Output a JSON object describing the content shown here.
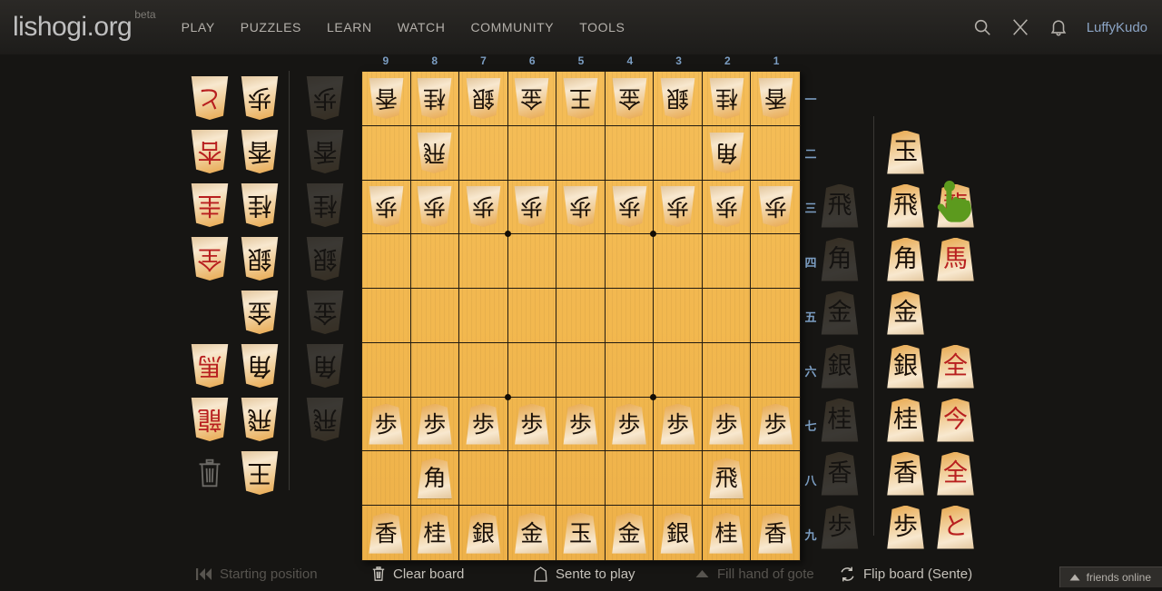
{
  "header": {
    "site_name": "lishogi.org",
    "beta_label": "beta",
    "nav": [
      {
        "label": "PLAY"
      },
      {
        "label": "PUZZLES"
      },
      {
        "label": "LEARN"
      },
      {
        "label": "WATCH"
      },
      {
        "label": "COMMUNITY"
      },
      {
        "label": "TOOLS"
      }
    ],
    "icons": [
      "search-icon",
      "challenge-swords-icon",
      "notifications-bell-icon"
    ],
    "username": "LuffyKudo"
  },
  "board": {
    "file_coords": [
      "9",
      "8",
      "7",
      "6",
      "5",
      "4",
      "3",
      "2",
      "1"
    ],
    "rank_coords": [
      "一",
      "二",
      "三",
      "四",
      "五",
      "六",
      "七",
      "八",
      "九"
    ],
    "rows": [
      [
        {
          "glyph": "香",
          "color": "gote",
          "promoted": false
        },
        {
          "glyph": "桂",
          "color": "gote",
          "promoted": false
        },
        {
          "glyph": "銀",
          "color": "gote",
          "promoted": false
        },
        {
          "glyph": "金",
          "color": "gote",
          "promoted": false
        },
        {
          "glyph": "王",
          "color": "gote",
          "promoted": false
        },
        {
          "glyph": "金",
          "color": "gote",
          "promoted": false
        },
        {
          "glyph": "銀",
          "color": "gote",
          "promoted": false
        },
        {
          "glyph": "桂",
          "color": "gote",
          "promoted": false
        },
        {
          "glyph": "香",
          "color": "gote",
          "promoted": false
        }
      ],
      [
        null,
        {
          "glyph": "飛",
          "color": "gote",
          "promoted": false
        },
        null,
        null,
        null,
        null,
        null,
        {
          "glyph": "角",
          "color": "gote",
          "promoted": false
        },
        null
      ],
      [
        {
          "glyph": "歩",
          "color": "gote",
          "promoted": false
        },
        {
          "glyph": "歩",
          "color": "gote",
          "promoted": false
        },
        {
          "glyph": "歩",
          "color": "gote",
          "promoted": false
        },
        {
          "glyph": "歩",
          "color": "gote",
          "promoted": false
        },
        {
          "glyph": "歩",
          "color": "gote",
          "promoted": false
        },
        {
          "glyph": "歩",
          "color": "gote",
          "promoted": false
        },
        {
          "glyph": "歩",
          "color": "gote",
          "promoted": false
        },
        {
          "glyph": "歩",
          "color": "gote",
          "promoted": false
        },
        {
          "glyph": "歩",
          "color": "gote",
          "promoted": false
        }
      ],
      [
        null,
        null,
        null,
        null,
        null,
        null,
        null,
        null,
        null
      ],
      [
        null,
        null,
        null,
        null,
        null,
        null,
        null,
        null,
        null
      ],
      [
        null,
        null,
        null,
        null,
        null,
        null,
        null,
        null,
        null
      ],
      [
        {
          "glyph": "歩",
          "color": "sente",
          "promoted": false
        },
        {
          "glyph": "歩",
          "color": "sente",
          "promoted": false
        },
        {
          "glyph": "歩",
          "color": "sente",
          "promoted": false
        },
        {
          "glyph": "歩",
          "color": "sente",
          "promoted": false
        },
        {
          "glyph": "歩",
          "color": "sente",
          "promoted": false
        },
        {
          "glyph": "歩",
          "color": "sente",
          "promoted": false
        },
        {
          "glyph": "歩",
          "color": "sente",
          "promoted": false
        },
        {
          "glyph": "歩",
          "color": "sente",
          "promoted": false
        },
        {
          "glyph": "歩",
          "color": "sente",
          "promoted": false
        }
      ],
      [
        null,
        {
          "glyph": "角",
          "color": "sente",
          "promoted": false
        },
        null,
        null,
        null,
        null,
        null,
        {
          "glyph": "飛",
          "color": "sente",
          "promoted": false
        },
        null
      ],
      [
        {
          "glyph": "香",
          "color": "sente",
          "promoted": false
        },
        {
          "glyph": "桂",
          "color": "sente",
          "promoted": false
        },
        {
          "glyph": "銀",
          "color": "sente",
          "promoted": false
        },
        {
          "glyph": "金",
          "color": "sente",
          "promoted": false
        },
        {
          "glyph": "玉",
          "color": "sente",
          "promoted": false
        },
        {
          "glyph": "金",
          "color": "sente",
          "promoted": false
        },
        {
          "glyph": "銀",
          "color": "sente",
          "promoted": false
        },
        {
          "glyph": "桂",
          "color": "sente",
          "promoted": false
        },
        {
          "glyph": "香",
          "color": "sente",
          "promoted": false
        }
      ]
    ]
  },
  "gote_spares": {
    "promoted_column": [
      {
        "glyph": "と",
        "promoted": true
      },
      {
        "glyph": "杏",
        "promoted": true
      },
      {
        "glyph": "圭",
        "promoted": true
      },
      {
        "glyph": "全",
        "promoted": true
      },
      null,
      {
        "glyph": "馬",
        "promoted": true
      },
      {
        "glyph": "龍",
        "promoted": true
      },
      null
    ],
    "plain_column": [
      {
        "glyph": "歩",
        "promoted": false
      },
      {
        "glyph": "香",
        "promoted": false
      },
      {
        "glyph": "桂",
        "promoted": false
      },
      {
        "glyph": "銀",
        "promoted": false
      },
      {
        "glyph": "金",
        "promoted": false
      },
      {
        "glyph": "角",
        "promoted": false
      },
      {
        "glyph": "飛",
        "promoted": false
      },
      {
        "glyph": "王",
        "promoted": false
      }
    ],
    "trash_icon": "trash-icon"
  },
  "sente_spares": {
    "plain_column": [
      {
        "glyph": "玉",
        "promoted": false
      },
      {
        "glyph": "飛",
        "promoted": false
      },
      {
        "glyph": "角",
        "promoted": false
      },
      {
        "glyph": "金",
        "promoted": false
      },
      {
        "glyph": "銀",
        "promoted": false
      },
      {
        "glyph": "桂",
        "promoted": false
      },
      {
        "glyph": "香",
        "promoted": false
      },
      {
        "glyph": "歩",
        "promoted": false
      }
    ],
    "promoted_column": [
      null,
      {
        "glyph": "龍",
        "promoted": true
      },
      {
        "glyph": "馬",
        "promoted": true
      },
      null,
      {
        "glyph": "全",
        "promoted": true
      },
      {
        "glyph": "今",
        "promoted": true
      },
      {
        "glyph": "全",
        "promoted": true
      },
      {
        "glyph": "と",
        "promoted": true
      }
    ],
    "cursor_icon": "pointing-hand-cursor-icon"
  },
  "gote_hand": [
    {
      "glyph": "歩"
    },
    {
      "glyph": "香"
    },
    {
      "glyph": "桂"
    },
    {
      "glyph": "銀"
    },
    {
      "glyph": "金"
    },
    {
      "glyph": "角"
    },
    {
      "glyph": "飛"
    },
    null
  ],
  "sente_hand": [
    null,
    {
      "glyph": "飛"
    },
    {
      "glyph": "角"
    },
    {
      "glyph": "金"
    },
    {
      "glyph": "銀"
    },
    {
      "glyph": "桂"
    },
    {
      "glyph": "香"
    },
    {
      "glyph": "歩"
    }
  ],
  "toolbar": [
    {
      "label": "Starting position",
      "icon": "rewind-icon",
      "disabled": true
    },
    {
      "label": "Clear board",
      "icon": "trash-icon",
      "disabled": false
    },
    {
      "label": "Sente to play",
      "icon": "sente-koma-icon",
      "disabled": false
    },
    {
      "label": "Fill hand of gote",
      "icon": "triangle-up-icon",
      "disabled": true
    },
    {
      "label": "Flip board (Sente)",
      "icon": "flip-icon",
      "disabled": false
    }
  ],
  "friends_online": {
    "label": "friends online",
    "icon": "chevron-up-icon"
  },
  "colors": {
    "page_bg": "#161513",
    "header_bg": "#2b2926",
    "board_light": "#f5bd58",
    "board_line": "#211a10",
    "coord_blue": "#7b9dc2",
    "promoted_red": "#b81f1f",
    "username_blue": "#8ba4c4",
    "cursor_green": "#5c9a1e"
  }
}
